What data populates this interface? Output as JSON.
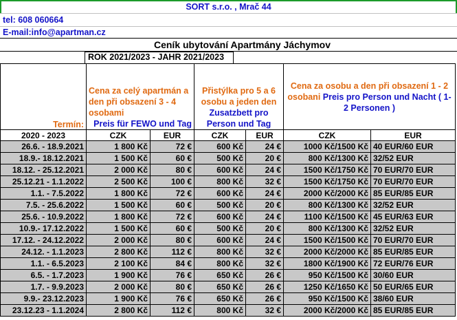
{
  "header": {
    "company": "SORT s.r.o. , Mrač 44",
    "phone": "tel: 608 060664",
    "email": "E-mail:info@apartman.cz",
    "title": "Ceník ubytování Apartmány Jáchymov",
    "year": "ROK 2021/2023  -  JAHR 2021/2023"
  },
  "columns": {
    "termin": "Termín:",
    "apt_cz": "Cena za celý apartmán a den při obsazení  3 - 4 osobami",
    "apt_de": "Preis für FEWO und Tag",
    "extra_cz": "Přistýlka pro 5 a 6 osobu a jeden den",
    "extra_de": "Zusatzbett pro Person und Tag",
    "person_cz": "Cena za osobu a den při obsazení 1 - 2 osobani",
    "person_de": "Preis pro Person und Nacht ( 1-2 Personen )",
    "period": "2020 - 2023",
    "czk": "CZK",
    "eur": "EUR"
  },
  "rows": [
    {
      "term": "26.6. - 18.9.2021",
      "apt_czk": "1 800 Kč",
      "apt_eur": "72 €",
      "ext_czk": "600 Kč",
      "ext_eur": "24 €",
      "p_czk": "1000 Kč/1500 Kč",
      "p_eur": "40 EUR/60 EUR"
    },
    {
      "term": "18.9.- 18.12.2021",
      "apt_czk": "1 500 Kč",
      "apt_eur": "60 €",
      "ext_czk": "500 Kč",
      "ext_eur": "20 €",
      "p_czk": "800 Kč/1300 Kč",
      "p_eur": "32/52 EUR"
    },
    {
      "term": "18.12. - 25.12.2021",
      "apt_czk": "2 000 Kč",
      "apt_eur": "80 €",
      "ext_czk": "600 Kč",
      "ext_eur": "24 €",
      "p_czk": "1500 Kč/1750 Kč",
      "p_eur": "70 EUR/70 EUR"
    },
    {
      "term": "25.12.21 - 1.1.2022",
      "apt_czk": "2 500 Kč",
      "apt_eur": "100 €",
      "ext_czk": "800 Kč",
      "ext_eur": "32 €",
      "p_czk": "1500 Kč/1750 Kč",
      "p_eur": "70 EUR/70 EUR"
    },
    {
      "term": "1.1. - 7.5.2022",
      "apt_czk": "1 800 Kč",
      "apt_eur": "72 €",
      "ext_czk": "600 Kč",
      "ext_eur": "24 €",
      "p_czk": "2000 Kč/2000 Kč",
      "p_eur": "85 EUR/85 EUR"
    },
    {
      "term": "7.5. - 25.6.2022",
      "apt_czk": "1 500 Kč",
      "apt_eur": "60 €",
      "ext_czk": "500 Kč",
      "ext_eur": "20 €",
      "p_czk": "800 Kč/1300 Kč",
      "p_eur": "32/52 EUR"
    },
    {
      "term": "25.6. - 10.9.2022",
      "apt_czk": "1 800 Kč",
      "apt_eur": "72 €",
      "ext_czk": "600 Kč",
      "ext_eur": "24 €",
      "p_czk": "1100 Kč/1500 Kč",
      "p_eur": "45 EUR/63 EUR"
    },
    {
      "term": "10.9.- 17.12.2022",
      "apt_czk": "1 500 Kč",
      "apt_eur": "60 €",
      "ext_czk": "500 Kč",
      "ext_eur": "20 €",
      "p_czk": "800 Kč/1300 Kč",
      "p_eur": "32/52 EUR"
    },
    {
      "term": "17.12. - 24.12.2022",
      "apt_czk": "2 000 Kč",
      "apt_eur": "80 €",
      "ext_czk": "600 Kč",
      "ext_eur": "24 €",
      "p_czk": "1500 Kč/1500 Kč",
      "p_eur": "70 EUR/70 EUR"
    },
    {
      "term": "24.12. - 1.1.2023",
      "apt_czk": "2 800 Kč",
      "apt_eur": "112 €",
      "ext_czk": "800 Kč",
      "ext_eur": "32 €",
      "p_czk": "2000 Kč/2000 Kč",
      "p_eur": "85 EUR/85 EUR"
    },
    {
      "term": "1.1. - 6.5.2023",
      "apt_czk": "2 100 Kč",
      "apt_eur": "84 €",
      "ext_czk": "800 Kč",
      "ext_eur": "32 €",
      "p_czk": "1800 Kč/1900 Kč",
      "p_eur": "72 EUR/76 EUR"
    },
    {
      "term": "6.5. - 1.7.2023",
      "apt_czk": "1 900 Kč",
      "apt_eur": "76 €",
      "ext_czk": "650 Kč",
      "ext_eur": "26 €",
      "p_czk": "950 Kč/1500 Kč",
      "p_eur": "30/60 EUR"
    },
    {
      "term": "1.7. - 9.9.2023",
      "apt_czk": "2 000 Kč",
      "apt_eur": "80 €",
      "ext_czk": "650 Kč",
      "ext_eur": "26 €",
      "p_czk": "1250 Kč/1650 Kč",
      "p_eur": "50 EUR/65 EUR"
    },
    {
      "term": "9.9.- 23.12.2023",
      "apt_czk": "1 900 Kč",
      "apt_eur": "76 €",
      "ext_czk": "650 Kč",
      "ext_eur": "26 €",
      "p_czk": "950 Kč/1500 Kč",
      "p_eur": "38/60 EUR"
    },
    {
      "term": "23.12.23 - 1.1.2024",
      "apt_czk": "2 800 Kč",
      "apt_eur": "112 €",
      "ext_czk": "800 Kč",
      "ext_eur": "32 €",
      "p_czk": "2000 Kč/2000 Kč",
      "p_eur": "85 EUR/85 EUR"
    }
  ]
}
